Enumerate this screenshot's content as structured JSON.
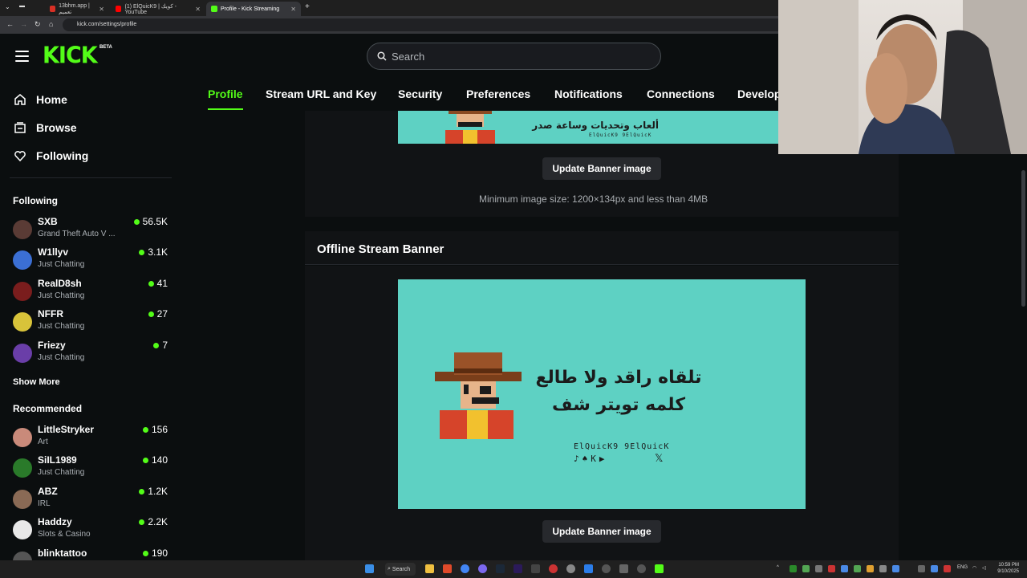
{
  "browser": {
    "tabs": [
      {
        "title": "13bhm.app | تعميم",
        "color": "#d93025"
      },
      {
        "title": "(1) ElQuicK9 | كويك - YouTube",
        "color": "#ff0000"
      },
      {
        "title": "Profile - Kick Streaming",
        "color": "#53fc18"
      }
    ],
    "url": "kick.com/settings/profile"
  },
  "header": {
    "logo": "KICK",
    "beta": "BETA",
    "search_placeholder": "Search"
  },
  "sidebar": {
    "nav": [
      {
        "label": "Home",
        "icon": "home-icon"
      },
      {
        "label": "Browse",
        "icon": "browse-icon"
      },
      {
        "label": "Following",
        "icon": "heart-icon"
      }
    ],
    "following_title": "Following",
    "following": [
      {
        "name": "SXB",
        "category": "Grand Theft Auto V ...",
        "viewers": "56.5K",
        "avatar": "#5a3b35"
      },
      {
        "name": "W1llyv",
        "category": "Just Chatting",
        "viewers": "3.1K",
        "avatar": "#3b6fd4"
      },
      {
        "name": "RealD8sh",
        "category": "Just Chatting",
        "viewers": "41",
        "avatar": "#7a1d1d"
      },
      {
        "name": "NFFR",
        "category": "Just Chatting",
        "viewers": "27",
        "avatar": "#d8c33a"
      },
      {
        "name": "Friezy",
        "category": "Just Chatting",
        "viewers": "7",
        "avatar": "#6a3ea8"
      }
    ],
    "show_more": "Show More",
    "recommended_title": "Recommended",
    "recommended": [
      {
        "name": "LittleStryker",
        "category": "Art",
        "viewers": "156",
        "avatar": "#c98a7a"
      },
      {
        "name": "SiIL1989",
        "category": "Just Chatting",
        "viewers": "140",
        "avatar": "#2a7a2a"
      },
      {
        "name": "ABZ",
        "category": "IRL",
        "viewers": "1.2K",
        "avatar": "#8a6a55"
      },
      {
        "name": "Haddzy",
        "category": "Slots & Casino",
        "viewers": "2.2K",
        "avatar": "#e8e8e8"
      },
      {
        "name": "blinktattoo",
        "category": "",
        "viewers": "190",
        "avatar": "#555555"
      }
    ]
  },
  "settings_tabs": [
    "Profile",
    "Stream URL and Key",
    "Security",
    "Preferences",
    "Notifications",
    "Connections",
    "Develop"
  ],
  "content": {
    "banner_top_arabic": "ألعاب وتحديات وساعة صدر",
    "banner_top_handles": "ElQuicK9   9ElQuicK",
    "update_banner_label": "Update Banner image",
    "min_size_hint": "Minimum image size: 1200×134px and less than 4MB",
    "offline_title": "Offline Stream Banner",
    "offline_arabic_line1": "تلقاه راقد ولا طالع",
    "offline_arabic_line2": "كلمه تويتر شف",
    "offline_handles": "ElQuicK9  9ElQuicK",
    "offline_update_label": "Update Banner image",
    "banner_color": "#5ed1c3"
  },
  "taskbar": {
    "search": "Search",
    "lang": "ENG",
    "time": "10:59 PM",
    "date": "9/10/2025"
  },
  "colors": {
    "accent": "#53fc18",
    "background": "#0b0e0f"
  }
}
